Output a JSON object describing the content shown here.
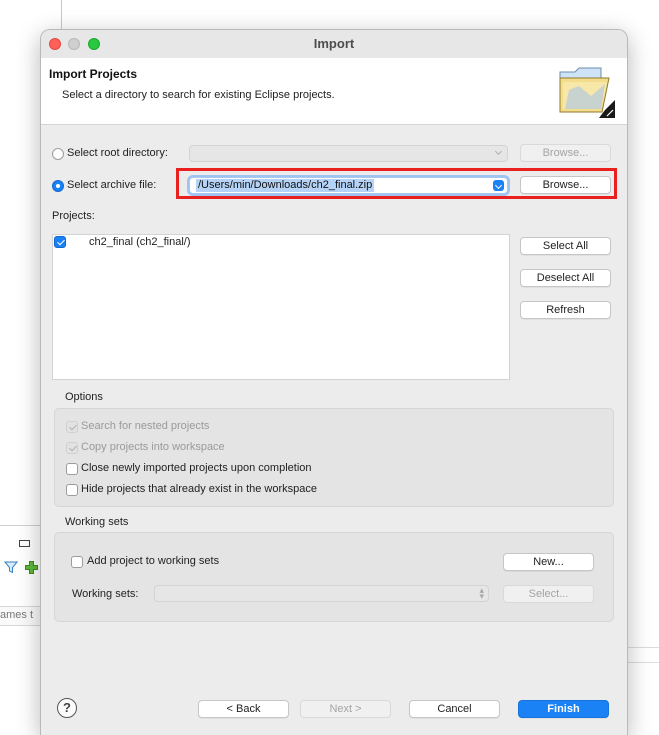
{
  "background": {
    "names_fragment": "ames t"
  },
  "dialog": {
    "title": "Import",
    "header": {
      "title": "Import Projects",
      "description": "Select a directory to search for existing Eclipse projects."
    },
    "source": {
      "root_directory_label": "Select root directory:",
      "root_directory_value": "",
      "archive_file_label": "Select archive file:",
      "archive_file_value": "/Users/min/Downloads/ch2_final.zip",
      "selected_option": "archive",
      "browse_label": "Browse...",
      "browse_archive_label": "Browse..."
    },
    "projects": {
      "label": "Projects:",
      "items": [
        {
          "name": "ch2_final (ch2_final/)",
          "checked": true
        }
      ],
      "select_all": "Select All",
      "deselect_all": "Deselect All",
      "refresh": "Refresh"
    },
    "options": {
      "title": "Options",
      "items": [
        {
          "label": "Search for nested projects",
          "checked": true,
          "enabled": false
        },
        {
          "label": "Copy projects into workspace",
          "checked": true,
          "enabled": false
        },
        {
          "label": "Close newly imported projects upon completion",
          "checked": false,
          "enabled": true
        },
        {
          "label": "Hide projects that already exist in the workspace",
          "checked": false,
          "enabled": true
        }
      ]
    },
    "working_sets": {
      "title": "Working sets",
      "add_label": "Add project to working sets",
      "add_checked": false,
      "new_label": "New...",
      "sets_label": "Working sets:",
      "sets_value": "",
      "select_label": "Select..."
    },
    "footer": {
      "help": "?",
      "back": "< Back",
      "next": "Next >",
      "cancel": "Cancel",
      "finish": "Finish"
    },
    "colors": {
      "accent": "#1a82f5",
      "highlight_box": "#e8211e"
    }
  }
}
